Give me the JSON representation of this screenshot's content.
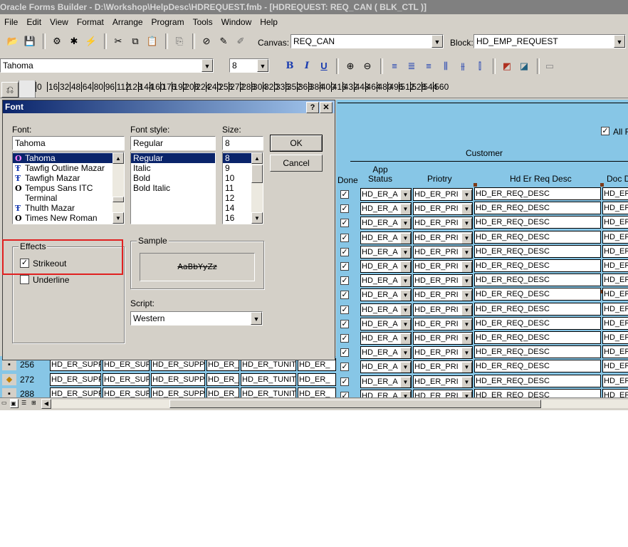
{
  "window": {
    "title": "Oracle Forms Builder - D:\\Workshop\\HelpDesc\\HDREQUEST.fmb - [HDREQUEST: REQ_CAN ( BLK_CTL )]"
  },
  "menu": [
    "File",
    "Edit",
    "View",
    "Format",
    "Arrange",
    "Program",
    "Tools",
    "Window",
    "Help"
  ],
  "toolbar": {
    "canvas_label": "Canvas:",
    "canvas_value": "REQ_CAN",
    "block_label": "Block:",
    "block_value": "HD_EMP_REQUEST",
    "font_name": "Tahoma",
    "font_size": "8"
  },
  "ruler": {
    "ticks": [
      "0",
      "16",
      "32",
      "48",
      "64",
      "80",
      "96",
      "112",
      "128",
      "144",
      "160",
      "176",
      "192",
      "208",
      "224",
      "240",
      "256",
      "272",
      "288",
      "304",
      "320",
      "336",
      "352",
      "368",
      "384",
      "400",
      "416",
      "432",
      "448",
      "464",
      "480",
      "496",
      "512",
      "528",
      "544",
      "560"
    ]
  },
  "layout_canvas": {
    "all_label": "All R",
    "group_header": "Customer",
    "headers": {
      "done": "Done",
      "app_status": "App Status",
      "priority": "Priotry",
      "req_desc": "Hd Er Req Desc",
      "doc": "Doc D"
    },
    "row_values": {
      "app_status": "HD_ER_A",
      "priority": "HD_ER_PRI",
      "req_desc": "HD_ER_REQ_DESC",
      "doc": "HD_ER"
    }
  },
  "left_grid": {
    "row_numbers": [
      "256",
      "272",
      "288"
    ],
    "cells": [
      "HD_ER_SUPP",
      "HD_ER_SUPP",
      "HD_ER_SUPP_F",
      "HD_ER_",
      "HD_ER_TUNIT",
      "HD_ER_"
    ]
  },
  "font_dialog": {
    "title": "Font",
    "help_btn": "?",
    "close_btn": "✕",
    "font_label": "Font:",
    "font_value": "Tahoma",
    "fonts": [
      {
        "icon": "O",
        "name": "Tahoma",
        "selected": true
      },
      {
        "icon": "T",
        "name": "Tawfig Outline Mazar"
      },
      {
        "icon": "T",
        "name": "Tawfigh Mazar"
      },
      {
        "icon": "O",
        "name": "Tempus Sans ITC"
      },
      {
        "icon": "",
        "name": "Terminal"
      },
      {
        "icon": "T",
        "name": "Thulth Mazar"
      },
      {
        "icon": "O",
        "name": "Times New Roman"
      }
    ],
    "style_label": "Font style:",
    "style_value": "Regular",
    "styles": [
      {
        "name": "Regular",
        "selected": true
      },
      {
        "name": "Italic"
      },
      {
        "name": "Bold"
      },
      {
        "name": "Bold Italic"
      }
    ],
    "size_label": "Size:",
    "size_value": "8",
    "sizes": [
      {
        "name": "8",
        "selected": true
      },
      {
        "name": "9"
      },
      {
        "name": "10"
      },
      {
        "name": "11"
      },
      {
        "name": "12"
      },
      {
        "name": "14"
      },
      {
        "name": "16"
      }
    ],
    "ok": "OK",
    "cancel": "Cancel",
    "effects_label": "Effects",
    "strikeout_label": "Strikeout",
    "strikeout_checked": true,
    "underline_label": "Underline",
    "underline_checked": false,
    "sample_label": "Sample",
    "sample_text": "AaBbYyZz",
    "script_label": "Script:",
    "script_value": "Western"
  },
  "colors": {
    "canvas": "#87c6e6",
    "highlight": "#e02020",
    "selection": "#0a246a"
  }
}
